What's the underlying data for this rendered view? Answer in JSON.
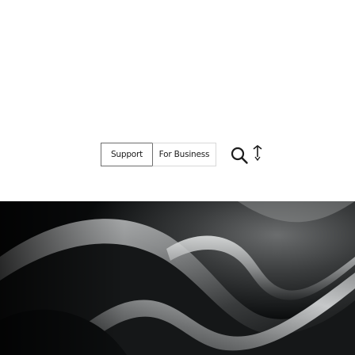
{
  "nav": {
    "links": [
      {
        "label": "Support"
      },
      {
        "label": "For Business"
      }
    ],
    "search_icon": "search-icon",
    "more_icon": "overflow-menu-icon"
  },
  "hero": {
    "image": "dark-abstract-wave-hero-image"
  },
  "colors": {
    "background": "#ffffff",
    "nav_border": "#6e6e6e",
    "nav_text": "#1c1c1c",
    "hero_dark": "#0a0c0d"
  }
}
